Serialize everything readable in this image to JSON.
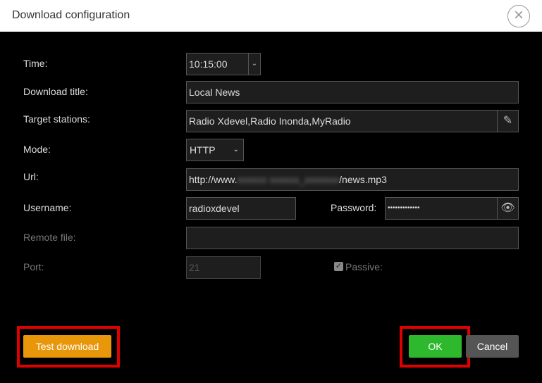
{
  "dialog": {
    "title": "Download configuration",
    "close_icon": "close-circle-icon"
  },
  "form": {
    "time_label": "Time:",
    "time_value": "10:15:00",
    "title_label": "Download title:",
    "title_value": "Local News",
    "stations_label": "Target stations:",
    "stations_value": "Radio Xdevel,Radio Inonda,MyRadio",
    "mode_label": "Mode:",
    "mode_value": "HTTP",
    "url_label": "Url:",
    "url_prefix": "http://www.",
    "url_suffix": "/news.mp3",
    "username_label": "Username:",
    "username_value": "radioxdevel",
    "password_label": "Password:",
    "password_value": "•••••••••••••",
    "remote_label": "Remote file:",
    "remote_value": "",
    "port_label": "Port:",
    "port_value": "21",
    "passive_label": "Passive:",
    "passive_checked": true
  },
  "buttons": {
    "test": "Test download",
    "ok": "OK",
    "cancel": "Cancel"
  },
  "colors": {
    "test": "#e8960a",
    "ok": "#2db82d",
    "cancel": "#555555",
    "highlight": "#e00000"
  }
}
